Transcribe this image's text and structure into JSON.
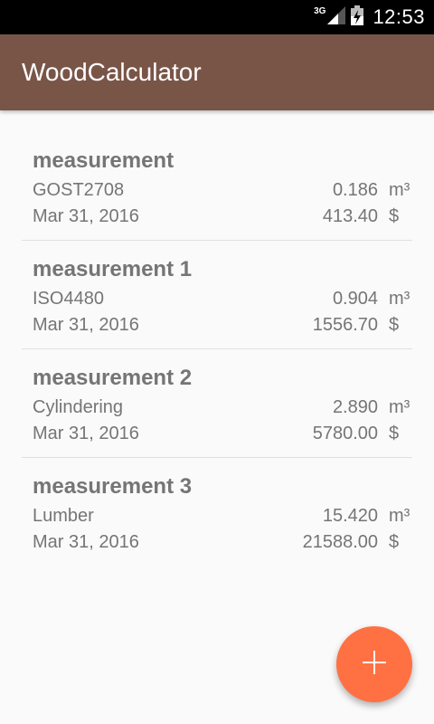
{
  "status_bar": {
    "network": "3G",
    "time": "12:53"
  },
  "app_bar": {
    "title": "WoodCalculator"
  },
  "measurements": [
    {
      "name": "measurement",
      "standard": "GOST2708",
      "volume": "0.186",
      "volume_unit": "m³",
      "date": "Mar 31, 2016",
      "price": "413.40",
      "currency": "$"
    },
    {
      "name": "measurement 1",
      "standard": "ISO4480",
      "volume": "0.904",
      "volume_unit": "m³",
      "date": "Mar 31, 2016",
      "price": "1556.70",
      "currency": "$"
    },
    {
      "name": "measurement 2",
      "standard": "Cylindering",
      "volume": "2.890",
      "volume_unit": "m³",
      "date": "Mar 31, 2016",
      "price": "5780.00",
      "currency": "$"
    },
    {
      "name": "measurement 3",
      "standard": "Lumber",
      "volume": "15.420",
      "volume_unit": "m³",
      "date": "Mar 31, 2016",
      "price": "21588.00",
      "currency": "$"
    }
  ],
  "fab": {
    "icon": "plus-icon"
  },
  "colors": {
    "app_bar": "#795548",
    "fab": "#ff7043",
    "text": "#757575"
  }
}
